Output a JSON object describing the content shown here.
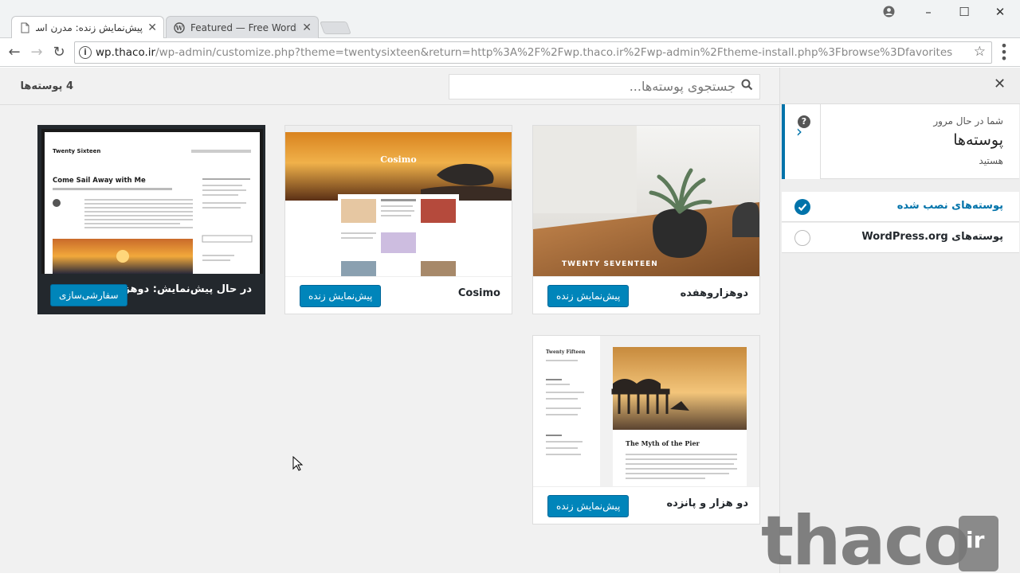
{
  "browser": {
    "tabs": [
      {
        "title": "پیش‌نمایش زنده: مدرن اسپ",
        "close": "✕"
      },
      {
        "title": "Featured — Free WordPress",
        "close": "✕"
      }
    ],
    "url_host": "wp.thaco.ir",
    "url_path": "/wp-admin/customize.php?theme=twentysixteen&return=http%3A%2F%2Fwp.thaco.ir%2Fwp-admin%2Ftheme-install.php%3Fbrowse%3Dfavorites"
  },
  "header": {
    "count": "4 پوسته‌ها",
    "search_placeholder": "جستجوی پوسته‌ها..."
  },
  "sidebar": {
    "line1": "شما در حال مرور",
    "line2": "پوسته‌ها",
    "line3": "هستید",
    "items": [
      {
        "label": "پوسته‌های نصب شده",
        "color": "#0073aa",
        "checked": true
      },
      {
        "label": "پوسته‌های WordPress.org",
        "color": "#23282d",
        "checked": false
      }
    ]
  },
  "themes": [
    {
      "name": "در حال پیش‌نمایش: دوهزار و",
      "button": "سفارشی‌سازی",
      "shot_title": "Twenty Sixteen",
      "shot_heading": "Come Sail Away with Me"
    },
    {
      "name": "Cosimo",
      "button": "پیش‌نمایش زنده",
      "shot_title": "Cosimo"
    },
    {
      "name": "دوهزاروهفده",
      "button": "پیش‌نمایش زنده",
      "shot_title": "TWENTY SEVENTEEN"
    },
    {
      "name": "دو هزار و پانزده",
      "button": "پیش‌نمایش زنده",
      "shot_title": "Twenty Fifteen",
      "shot_heading": "The Myth of the Pier"
    }
  ],
  "watermark": {
    "text": "thaco",
    "suffix": "ir"
  }
}
